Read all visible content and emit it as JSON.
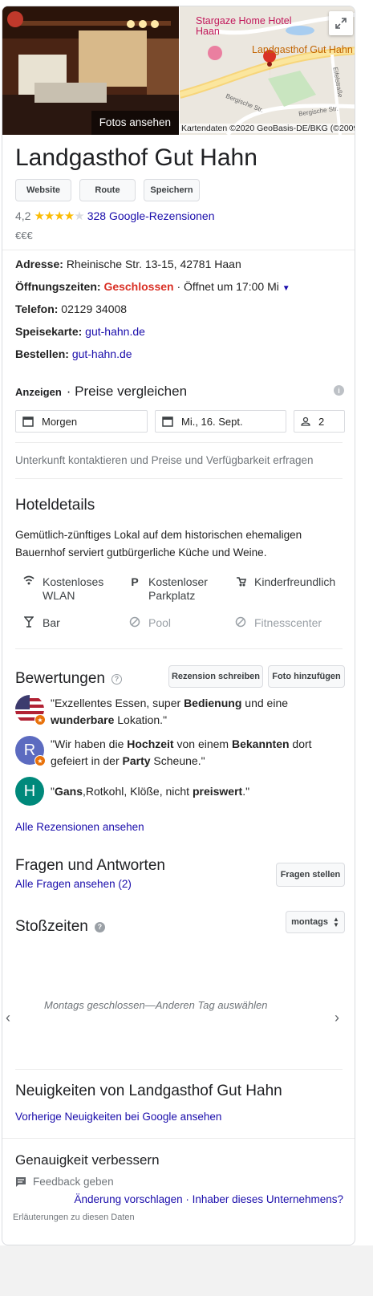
{
  "photo": {
    "button_label": "Fotos ansehen"
  },
  "map": {
    "poi_label": "Stargaze Home Hotel Haan",
    "place_label": "Landgasthof Gut Hahn",
    "road_1": "Bergische Str.",
    "road_2": "Bergische Str.",
    "road_3": "Eifelstraße",
    "credit": "Kartendaten ©2020 GeoBasis-DE/BKG (©2009)"
  },
  "business": {
    "name": "Landgasthof Gut Hahn",
    "actions": [
      "Website",
      "Route",
      "Speichern"
    ],
    "rating": "4,2",
    "rating_value": 4.2,
    "reviews_link": "328 Google-Rezensionen",
    "price": "€€€"
  },
  "details": {
    "address_label": "Adresse:",
    "address_value": "Rheinische Str. 13-15, 42781 Haan",
    "hours_label": "Öffnungszeiten:",
    "hours_status": "Geschlossen",
    "hours_next": "· Öffnet um 17:00 Mi",
    "phone_label": "Telefon:",
    "phone_value": "02129 34008",
    "menu_label": "Speisekarte:",
    "menu_value": "gut-hahn.de",
    "order_label": "Bestellen:",
    "order_value": "gut-hahn.de"
  },
  "prices": {
    "ads_label": "Anzeigen",
    "title": "· Preise vergleichen",
    "checkin": "Morgen",
    "checkout": "Mi., 16. Sept.",
    "guests": "2",
    "contact_note": "Unterkunft kontaktieren und Preise und Verfügbarkeit erfragen"
  },
  "hotel": {
    "title": "Hoteldetails",
    "description": "Gemütlich-zünftiges Lokal auf dem historischen ehemaligen Bauernhof serviert gutbürgerliche Küche und Weine.",
    "amenities": [
      {
        "label": "Kostenloses WLAN",
        "icon": "wifi-icon",
        "available": true
      },
      {
        "label": "Kostenloser Parkplatz",
        "icon": "parking-icon",
        "available": true
      },
      {
        "label": "Kinderfreundlich",
        "icon": "stroller-icon",
        "available": true
      },
      {
        "label": "Bar",
        "icon": "bar-icon",
        "available": true
      },
      {
        "label": "Pool",
        "icon": "not-available-icon",
        "available": false
      },
      {
        "label": "Fitnesscenter",
        "icon": "not-available-icon",
        "available": false
      }
    ]
  },
  "reviews": {
    "title": "Bewertungen",
    "write_button": "Rezension schreiben",
    "photo_button": "Foto hinzufügen",
    "r1_a": "\"Exzellentes Essen, super ",
    "r1_b": "Bedienung",
    "r1_c": " und eine ",
    "r1_d": "wunderbare",
    "r1_e": " Lokation.\"",
    "r2_a": "\"Wir haben die ",
    "r2_b": "Hochzeit",
    "r2_c": " von einem ",
    "r2_d": "Bekannten",
    "r2_e": " dort gefeiert in der ",
    "r2_f": "Party",
    "r2_g": " Scheune.\"",
    "r3_a": "\"",
    "r3_b": "Gans",
    "r3_c": ",Rotkohl, Klöße, nicht ",
    "r3_d": "preiswert",
    "r3_e": ".\"",
    "avatar2_letter": "R",
    "avatar3_letter": "H",
    "all_link": "Alle Rezensionen ansehen"
  },
  "qa": {
    "title": "Fragen und Antworten",
    "all_link": "Alle Fragen ansehen (2)",
    "ask_button": "Fragen stellen"
  },
  "busy": {
    "title": "Stoßzeiten",
    "day_select": "montags",
    "closed_note": "Montags geschlossen—Anderen Tag auswählen"
  },
  "news": {
    "title": "Neuigkeiten von Landgasthof Gut Hahn",
    "link": "Vorherige Neuigkeiten bei Google ansehen"
  },
  "accuracy": {
    "title": "Genauigkeit verbessern",
    "feedback": "Feedback geben",
    "suggest": "Änderung vorschlagen",
    "separator": " · ",
    "owner": "Inhaber dieses Unternehmens?"
  },
  "footer": {
    "note": "Erläuterungen zu diesen Daten"
  },
  "colors": {
    "link": "#1a0dab",
    "closed": "#d93025",
    "star": "#fbbc04",
    "avatar_r": "#5c6bc0",
    "avatar_h": "#00897b"
  }
}
